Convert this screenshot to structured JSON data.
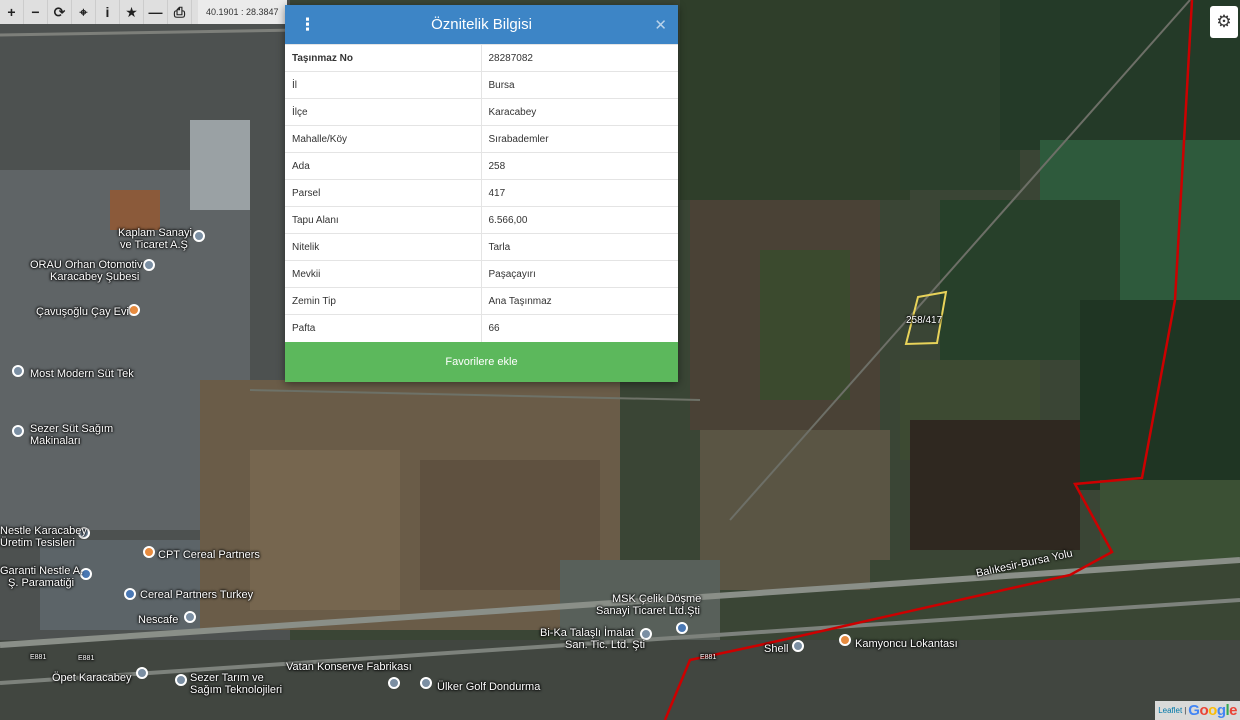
{
  "toolbar": {
    "buttons": [
      {
        "icon": "zoom-in-icon",
        "glyph": "+"
      },
      {
        "icon": "zoom-out-icon",
        "glyph": "−"
      },
      {
        "icon": "refresh-icon",
        "glyph": "⟳"
      },
      {
        "icon": "locate-icon",
        "glyph": "⌖"
      },
      {
        "icon": "info-icon",
        "glyph": "i"
      },
      {
        "icon": "star-icon",
        "glyph": "★"
      },
      {
        "icon": "measure-icon",
        "glyph": "—"
      },
      {
        "icon": "print-icon",
        "glyph": "⎙"
      }
    ],
    "coordinates": "40.1901 : 28.3847"
  },
  "settings": {
    "icon": "gear-icon",
    "glyph": "⚙"
  },
  "panel": {
    "title": "Öznitelik Bilgisi",
    "menu_glyph": "⋮",
    "close_glyph": "✕",
    "rows": [
      {
        "key": "Taşınmaz No",
        "value": "28287082"
      },
      {
        "key": "İl",
        "value": "Bursa"
      },
      {
        "key": "İlçe",
        "value": "Karacabey"
      },
      {
        "key": "Mahalle/Köy",
        "value": "Sırabademler"
      },
      {
        "key": "Ada",
        "value": "258"
      },
      {
        "key": "Parsel",
        "value": "417"
      },
      {
        "key": "Tapu Alanı",
        "value": "6.566,00"
      },
      {
        "key": "Nitelik",
        "value": "Tarla"
      },
      {
        "key": "Mevkii",
        "value": "Paşaçayırı"
      },
      {
        "key": "Zemin Tip",
        "value": "Ana Taşınmaz"
      },
      {
        "key": "Pafta",
        "value": "66"
      }
    ],
    "favorite_button": "Favorilere ekle"
  },
  "map": {
    "parcel_label": "258/417",
    "labels": [
      "Kaplam Sanayi",
      "ve Ticaret A.Ş",
      "ORAU Orhan Otomotiv",
      "Karacabey Şubesi",
      "Çavuşoğlu Çay Evi",
      "Most Modern Süt Tek",
      "Sezer Süt Sağım",
      "Makinaları",
      "Nestle Karacabey",
      "Üretim Tesisleri",
      "CPT Cereal Partners",
      "Garanti Nestle A.",
      "Ş. Paramatiği",
      "Cereal Partners Turkey",
      "Nescafe",
      "Vatan Konserve Fabrikası",
      "Öpet Karacabey",
      "Sezer Tarım ve",
      "Sağım Teknolojileri",
      "Ülker Golf Dondurma",
      "MSK Çelik Döşme",
      "Sanayi Ticaret Ltd.Şti",
      "Bi-Ka Talaşlı İmalat",
      "San. Tic. Ltd. Şti",
      "Shell",
      "Kamyoncu Lokantası",
      "Balıkesir-Bursa Yolu",
      "E881",
      "E881",
      "E881"
    ]
  },
  "attribution": {
    "leaflet": "Leaflet",
    "separator": "|",
    "google": "Google"
  },
  "colors": {
    "header": "#3d85c6",
    "favorite": "#5cb85c",
    "parcel_outline": "#e8d35a",
    "boundary": "#cc0000"
  }
}
